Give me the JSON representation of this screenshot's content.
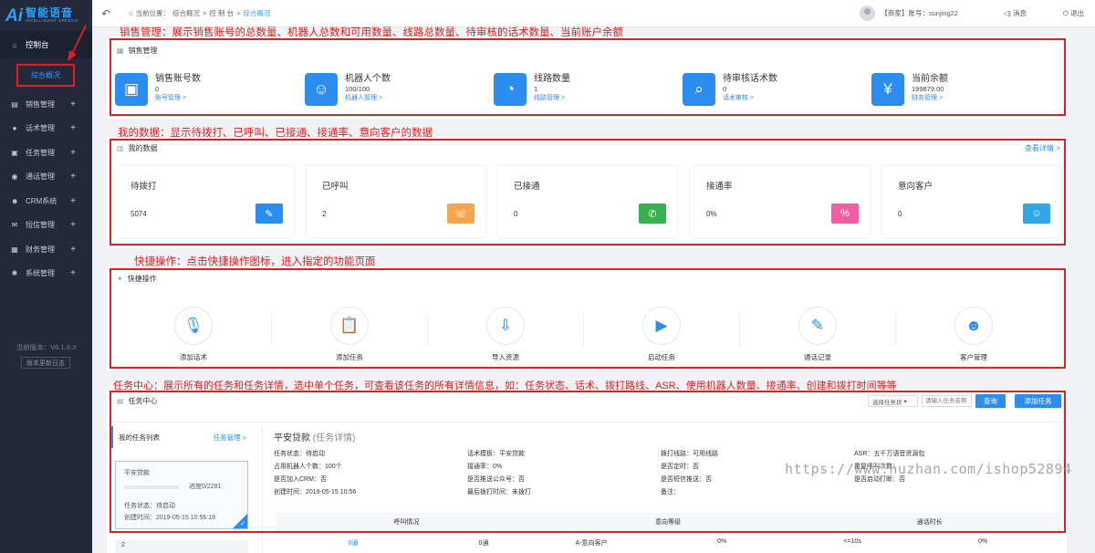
{
  "sidebar": {
    "logo_ai": "Ai",
    "logo_title": "智能语音",
    "logo_sub": "INTELLIGENT SPEECH",
    "home_label": "控制台",
    "overview_label": "综合概况",
    "items": [
      {
        "label": "销售管理",
        "icon": "cart-icon"
      },
      {
        "label": "话术管理",
        "icon": "mic-icon"
      },
      {
        "label": "任务管理",
        "icon": "clipboard-icon"
      },
      {
        "label": "通话管理",
        "icon": "phone-icon"
      },
      {
        "label": "CRM系统",
        "icon": "people-icon"
      },
      {
        "label": "短信管理",
        "icon": "envelope-icon"
      },
      {
        "label": "财务管理",
        "icon": "finance-icon"
      },
      {
        "label": "系统管理",
        "icon": "gear-icon"
      }
    ],
    "version": "当前版本：V6.1.8.3",
    "version_log": "版本更新日志"
  },
  "topbar": {
    "crumb_prefix": "当前位置：",
    "crumb_1": "综合概况",
    "crumb_2": "控 制 台",
    "crumb_3": "综合概况",
    "user": "【商家】账号：sunjing22",
    "message": "消息",
    "logout": "退出"
  },
  "annotations": {
    "sales": "销售管理：展示销售账号的总数量、机器人总数和可用数量、线路总数量、待审核的话术数量、当前账户余额",
    "mydata": "我的数据：显示待拨打、已呼叫、已接通、接通率、意向客户的数据",
    "quick": "快捷操作：点击快捷操作图标，进入指定的功能页面",
    "task": "任务中心：展示所有的任务和任务详情，选中单个任务，可查看该任务的所有详情信息，如：任务状态、话术、拨打路线、ASR、使用机器人数量、接通率、创建和拨打时间等等"
  },
  "sales": {
    "title": "销售管理",
    "items": [
      {
        "name": "销售账号数",
        "value": "0",
        "link": "账号管理 >",
        "icon": "account-icon"
      },
      {
        "name": "机器人个数",
        "value": "100/100",
        "link": "机器人管理 >",
        "icon": "robot-icon"
      },
      {
        "name": "线路数量",
        "value": "1",
        "link": "线路管理 >",
        "icon": "line-icon"
      },
      {
        "name": "待审核话术数",
        "value": "0",
        "link": "话术审核 >",
        "icon": "review-icon"
      },
      {
        "name": "当前余额",
        "value": "199879.00",
        "link": "财务管理 >",
        "icon": "money-bag-icon"
      }
    ]
  },
  "mydata": {
    "title": "我的数据",
    "more": "查看详情 >",
    "items": [
      {
        "name": "待拨打",
        "value": "5074",
        "color": "#2c8df0",
        "icon": "to-dial-icon"
      },
      {
        "name": "已呼叫",
        "value": "2",
        "color": "#f5a54a",
        "icon": "called-icon"
      },
      {
        "name": "已接通",
        "value": "0",
        "color": "#36b14f",
        "icon": "connected-icon"
      },
      {
        "name": "接通率",
        "value": "0%",
        "color": "#f25ea3",
        "icon": "percent-icon"
      },
      {
        "name": "意向客户",
        "value": "0",
        "color": "#2fa7e6",
        "icon": "intent-customer-icon"
      }
    ]
  },
  "quick": {
    "title": "快捷操作",
    "items": [
      {
        "label": "添加话术",
        "icon": "mic-icon"
      },
      {
        "label": "添加任务",
        "icon": "clipboard-icon"
      },
      {
        "label": "导入资源",
        "icon": "import-icon"
      },
      {
        "label": "启动任务",
        "icon": "play-icon"
      },
      {
        "label": "通话记录",
        "icon": "record-icon"
      },
      {
        "label": "客户管理",
        "icon": "customer-icon"
      }
    ]
  },
  "task": {
    "title": "任务中心",
    "select": "选择任务状",
    "search_placeholder": "请输入任务名称",
    "query_button": "查询",
    "add_button": "添加任务",
    "list_title": "我的任务列表",
    "list_link": "任务管理 >",
    "card": {
      "name": "平安贷款",
      "progress": "进度0/2281",
      "status": "任务状态：待启动",
      "created": "创建时间：2019-05-15 10:56:18"
    },
    "card2_index": "2",
    "detail_name": "平安贷款",
    "detail_suffix": "(任务详情)",
    "details": [
      "任务状态：待启动",
      "话术模板：平安贷款",
      "拨打线路：可用线路",
      "ASR：五千万语音资源包",
      "占用机器人个数：100个",
      "接通率：0%",
      "是否定时：否",
      "重复呼叫次数：",
      "是否加入CRM：否",
      "是否推送公众号：否",
      "是否短信推送：否",
      "是否启动打断：否",
      "创建时间：2019-05-15 10:56",
      "最后拨打时间：未拨打",
      "备注：",
      ""
    ],
    "table_headers": [
      "呼叫情况",
      "意向等级",
      "通话时长"
    ],
    "row": [
      "0通",
      "0通",
      "A-意向客户",
      "0%",
      "<=10s",
      "0%"
    ]
  },
  "watermark": "https://www.huzhan.com/ishop52894"
}
